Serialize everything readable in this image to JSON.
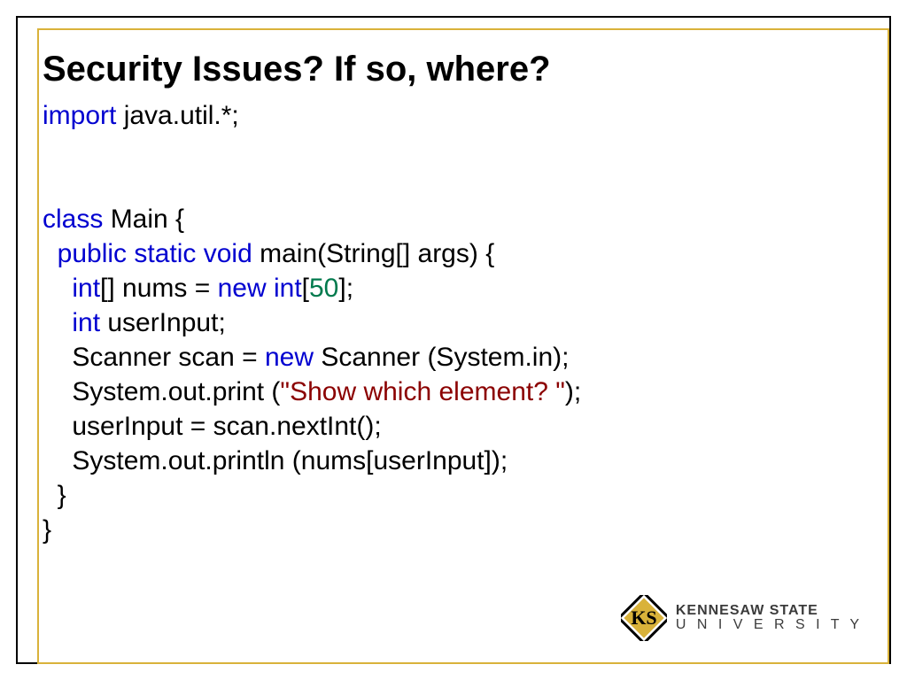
{
  "title": "Security Issues? If so, where?",
  "code": {
    "kw_import": "import",
    "t_import_rest": " java.util.*;",
    "kw_class": "class",
    "t_class_rest": " Main {",
    "indent1": "  ",
    "kw_public_static_void": "public static void",
    "t_main_sig": " main(String[] args) {",
    "indent2": "    ",
    "kw_int1": "int",
    "t_nums_eq": "[] nums = ",
    "kw_new_int": "new int",
    "t_bracket_open": "[",
    "num_50": "50",
    "t_bracket_close_semi": "];",
    "kw_int2": "int",
    "t_userInput_decl": " userInput;",
    "t_scanner_pre": "Scanner scan = ",
    "kw_new": "new",
    "t_scanner_post": " Scanner (System.in);",
    "t_print_pre": "System.out.print (",
    "str_prompt": "\"Show which element? \"",
    "t_print_post": ");",
    "t_assign": "userInput = scan.nextInt();",
    "t_println": "System.out.println (nums[userInput]);",
    "t_close_method": "}",
    "t_close_class": "}"
  },
  "logo": {
    "line1": "KENNESAW STATE",
    "line2": "U N I V E R S I T Y"
  }
}
